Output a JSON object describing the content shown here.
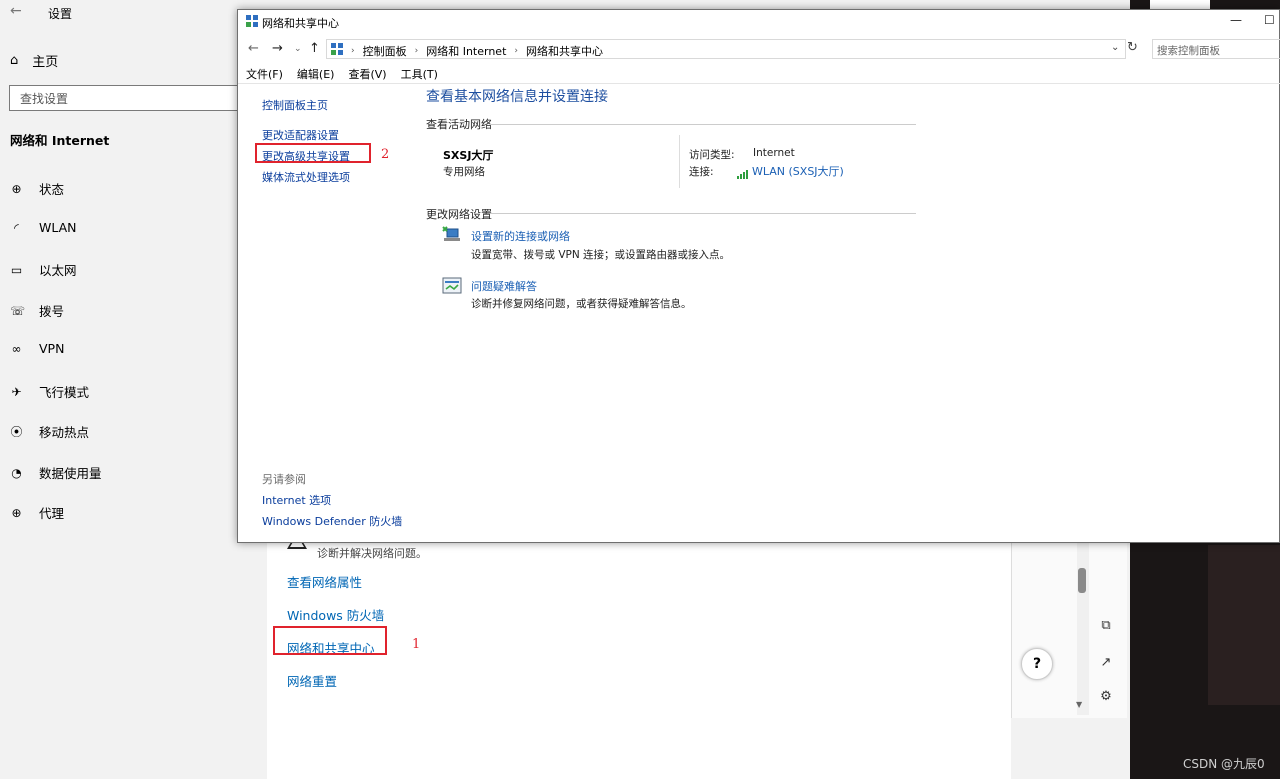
{
  "settings": {
    "title": "设置",
    "home": "主页",
    "search_placeholder": "查找设置",
    "section": "网络和 Internet",
    "nav": [
      "状态",
      "WLAN",
      "以太网",
      "拨号",
      "VPN",
      "飞行模式",
      "移动热点",
      "数据使用量",
      "代理"
    ],
    "main": {
      "troubleshoot_desc": "诊断并解决网络问题。",
      "links": [
        "查看网络属性",
        "Windows 防火墙",
        "网络和共享中心",
        "网络重置"
      ],
      "annotation_1": "1"
    }
  },
  "window": {
    "title": "网络和共享中心",
    "breadcrumb": [
      "控制面板",
      "网络和 Internet",
      "网络和共享中心"
    ],
    "search_placeholder": "搜索控制面板",
    "menu": [
      "文件(F)",
      "编辑(E)",
      "查看(V)",
      "工具(T)"
    ],
    "sidebar": {
      "home": "控制面板主页",
      "links": [
        "更改适配器设置",
        "更改高级共享设置",
        "媒体流式处理选项"
      ],
      "annotation_2": "2",
      "see_also_title": "另请参阅",
      "see_also": [
        "Internet 选项",
        "Windows Defender 防火墙"
      ]
    },
    "main": {
      "heading": "查看基本网络信息并设置连接",
      "active_networks_title": "查看活动网络",
      "network_name": "SXSJ大厅",
      "network_type": "专用网络",
      "access_type_label": "访问类型:",
      "access_type_value": "Internet",
      "connections_label": "连接:",
      "connection_value": "WLAN (SXSJ大厅)",
      "change_title": "更改网络设置",
      "tasks": [
        {
          "link": "设置新的连接或网络",
          "desc": "设置宽带、拨号或 VPN 连接；或设置路由器或接入点。"
        },
        {
          "link": "问题疑难解答",
          "desc": "诊断并修复网络问题，或者获得疑难解答信息。"
        }
      ]
    }
  },
  "watermark": "CSDN @九辰0",
  "colors": {
    "link": "#0a3d9c",
    "settings_link": "#0066b4",
    "annotation": "#e0232d",
    "heading": "#1e4fa0"
  }
}
